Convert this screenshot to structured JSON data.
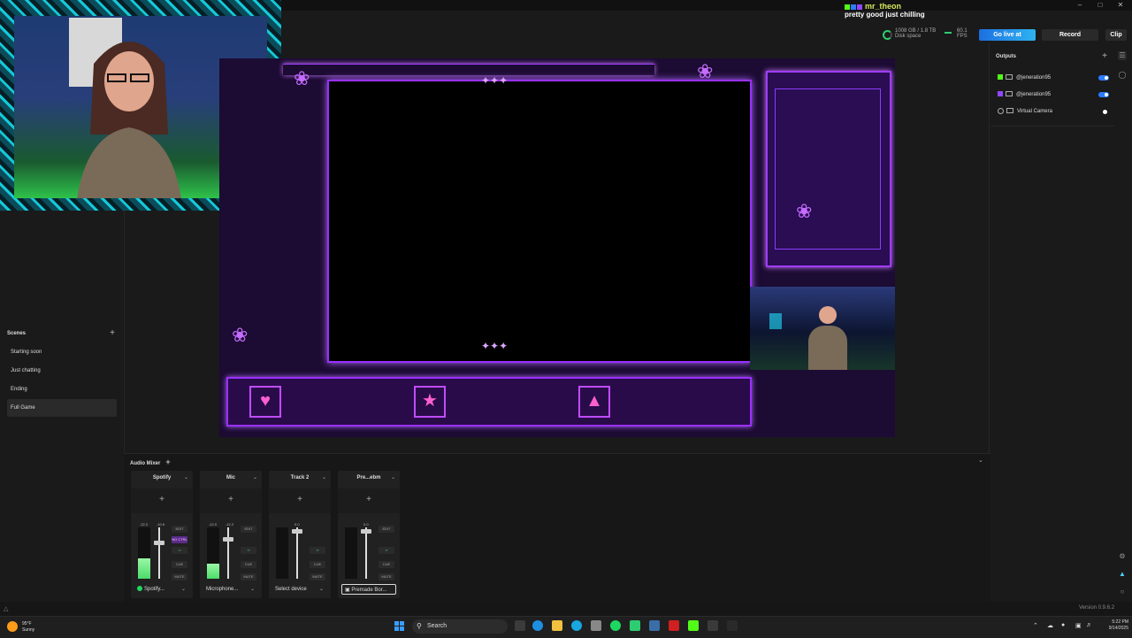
{
  "chat": {
    "user": "mr_theon",
    "message": "pretty good just chilling"
  },
  "stats": {
    "disk": "1008 GB / 1.8 TB",
    "disk_label": "Disk space",
    "fps_value": "60.1",
    "fps_label": "FPS"
  },
  "toolbar": {
    "go_live": "Go live at",
    "record": "Record",
    "clip": "Clip"
  },
  "scenes": {
    "title": "Scenes",
    "items": [
      "Starting soon",
      "Just chatting",
      "Ending",
      "Full Game"
    ],
    "selected": "Full Game"
  },
  "outputs": {
    "title": "Outputs",
    "items": [
      {
        "label": "@jeneration95",
        "platform_color": "#53fc18",
        "enabled": true
      },
      {
        "label": "@jeneration95",
        "platform_color": "#9146ff",
        "enabled": true
      },
      {
        "label": "Virtual Camera",
        "enabled": true
      }
    ]
  },
  "mixer": {
    "title": "Audio Mixer",
    "channels": [
      {
        "name": "Spotify",
        "db_left": "-22.2",
        "db_right": "-10.6",
        "meter_level": 0.4,
        "fader_level": 0.7,
        "device": "Spotify...",
        "buttons": [
          "EDIT",
          "NO CTRL",
          "CUE",
          "MUTE"
        ]
      },
      {
        "name": "Mic",
        "db_left": "-12.0",
        "db_right": "-12.2",
        "meter_level": 0.3,
        "fader_level": 0.78,
        "device": "Microphone...",
        "buttons": [
          "EDIT",
          "CUE",
          "MUTE"
        ]
      },
      {
        "name": "Track 2",
        "db_left": "",
        "db_right": "0.0",
        "meter_level": 0,
        "fader_level": 0.93,
        "device": "Select device",
        "buttons": [
          "CUE",
          "MUTE"
        ]
      },
      {
        "name": "Pre...ebm",
        "db_left": "",
        "db_right": "0.0",
        "meter_level": 0,
        "fader_level": 0.93,
        "device": "Premade Bor...",
        "buttons": [
          "EDIT",
          "CUE",
          "MUTE"
        ]
      }
    ]
  },
  "status": {
    "version": "Version 0.9.6.2"
  },
  "taskbar": {
    "weather_temp": "95°F",
    "weather_desc": "Sunny",
    "search": "Search",
    "time": "5:22 PM",
    "date": "9/14/2025"
  },
  "colors": {
    "accent": "#2b7cff",
    "overlay_purple": "#a23cff",
    "meter_green": "#4cdc6a"
  }
}
